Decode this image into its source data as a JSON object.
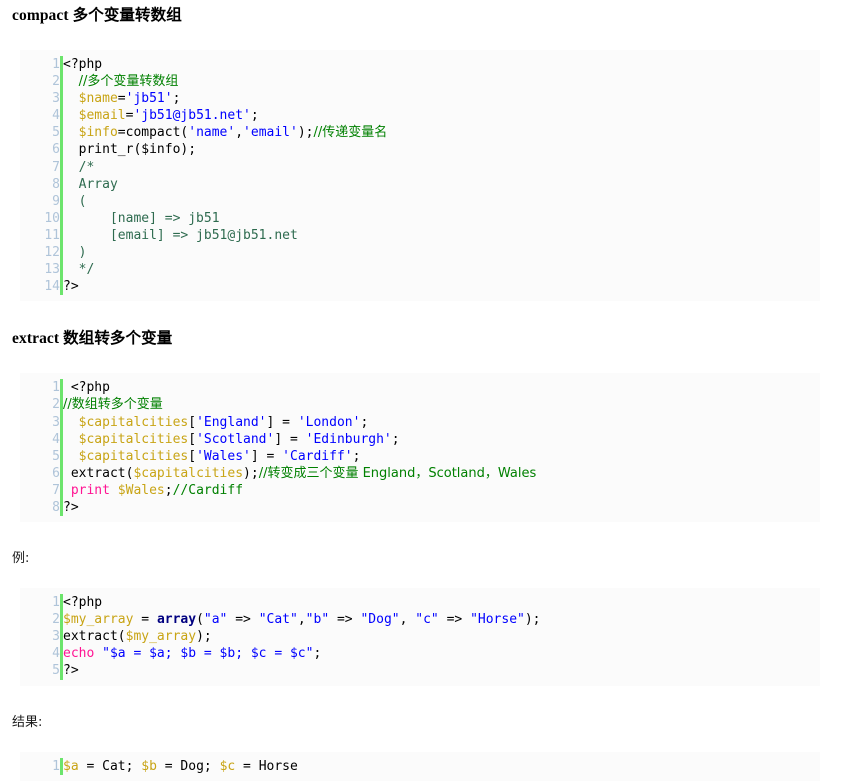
{
  "page": {
    "title": "PHP compact / extract 示例",
    "background": "#ffffff",
    "code_background": "#fbfbfb",
    "gutter_accent": "#6ce46c",
    "gutter_color": "#afc4d9"
  },
  "colors": {
    "variable": "#c8a415",
    "string": "#0000ff",
    "comment": "#008000",
    "block_comment": "#2e6b4f",
    "keyword": "#000080",
    "print_keyword": "#ff1493",
    "plain": "#000000"
  },
  "sections": [
    {
      "id": "compact",
      "heading": "compact 多个变量转数组",
      "block": {
        "line_numbers": [
          "1",
          "2",
          "3",
          "4",
          "5",
          "6",
          "7",
          "8",
          "9",
          "10",
          "11",
          "12",
          "13",
          "14"
        ],
        "lines": [
          [
            {
              "t": "<?php",
              "c": "plain"
            }
          ],
          [
            {
              "t": "  ",
              "c": "plain"
            },
            {
              "t": "//多个变量转数组",
              "c": "cjkcom"
            }
          ],
          [
            {
              "t": "  ",
              "c": "plain"
            },
            {
              "t": "$name",
              "c": "var"
            },
            {
              "t": "=",
              "c": "plain"
            },
            {
              "t": "'jb51'",
              "c": "str"
            },
            {
              "t": ";",
              "c": "plain"
            }
          ],
          [
            {
              "t": "  ",
              "c": "plain"
            },
            {
              "t": "$email",
              "c": "var"
            },
            {
              "t": "=",
              "c": "plain"
            },
            {
              "t": "'jb51@jb51.net'",
              "c": "str"
            },
            {
              "t": ";",
              "c": "plain"
            }
          ],
          [
            {
              "t": "  ",
              "c": "plain"
            },
            {
              "t": "$info",
              "c": "var"
            },
            {
              "t": "=compact(",
              "c": "plain"
            },
            {
              "t": "'name'",
              "c": "str"
            },
            {
              "t": ",",
              "c": "plain"
            },
            {
              "t": "'email'",
              "c": "str"
            },
            {
              "t": ");",
              "c": "plain"
            },
            {
              "t": "//传递变量名",
              "c": "cjkcom"
            }
          ],
          [
            {
              "t": "  print_r($info);",
              "c": "plain"
            }
          ],
          [
            {
              "t": "  ",
              "c": "plain"
            },
            {
              "t": "/*",
              "c": "blk"
            }
          ],
          [
            {
              "t": "  ",
              "c": "plain"
            },
            {
              "t": "Array",
              "c": "blk"
            }
          ],
          [
            {
              "t": "  ",
              "c": "plain"
            },
            {
              "t": "(",
              "c": "blk"
            }
          ],
          [
            {
              "t": "      ",
              "c": "plain"
            },
            {
              "t": "[name] => jb51",
              "c": "blk"
            }
          ],
          [
            {
              "t": "      ",
              "c": "plain"
            },
            {
              "t": "[email] => jb51@jb51.net",
              "c": "blk"
            }
          ],
          [
            {
              "t": "  ",
              "c": "plain"
            },
            {
              "t": ")",
              "c": "blk"
            }
          ],
          [
            {
              "t": "  ",
              "c": "plain"
            },
            {
              "t": "*/",
              "c": "blk"
            }
          ],
          [
            {
              "t": "?>",
              "c": "plain"
            }
          ]
        ]
      }
    },
    {
      "id": "extract",
      "heading": "extract 数组转多个变量",
      "block": {
        "line_numbers": [
          "1",
          "2",
          "3",
          "4",
          "5",
          "6",
          "7",
          "8"
        ],
        "lines": [
          [
            {
              "t": " <?php",
              "c": "plain"
            }
          ],
          [
            {
              "t": "//数组转多个变量",
              "c": "cjkcom"
            }
          ],
          [
            {
              "t": "  ",
              "c": "plain"
            },
            {
              "t": "$capitalcities",
              "c": "var"
            },
            {
              "t": "[",
              "c": "plain"
            },
            {
              "t": "'England'",
              "c": "str"
            },
            {
              "t": "] = ",
              "c": "plain"
            },
            {
              "t": "'London'",
              "c": "str"
            },
            {
              "t": ";",
              "c": "plain"
            }
          ],
          [
            {
              "t": "  ",
              "c": "plain"
            },
            {
              "t": "$capitalcities",
              "c": "var"
            },
            {
              "t": "[",
              "c": "plain"
            },
            {
              "t": "'Scotland'",
              "c": "str"
            },
            {
              "t": "] = ",
              "c": "plain"
            },
            {
              "t": "'Edinburgh'",
              "c": "str"
            },
            {
              "t": ";",
              "c": "plain"
            }
          ],
          [
            {
              "t": "  ",
              "c": "plain"
            },
            {
              "t": "$capitalcities",
              "c": "var"
            },
            {
              "t": "[",
              "c": "plain"
            },
            {
              "t": "'Wales'",
              "c": "str"
            },
            {
              "t": "] = ",
              "c": "plain"
            },
            {
              "t": "'Cardiff'",
              "c": "str"
            },
            {
              "t": ";",
              "c": "plain"
            }
          ],
          [
            {
              "t": " extract(",
              "c": "plain"
            },
            {
              "t": "$capitalcities",
              "c": "var"
            },
            {
              "t": ");",
              "c": "plain"
            },
            {
              "t": "//转变成三个变量 England，Scotland，Wales",
              "c": "cjkcom"
            }
          ],
          [
            {
              "t": " ",
              "c": "plain"
            },
            {
              "t": "print",
              "c": "pink"
            },
            {
              "t": " ",
              "c": "plain"
            },
            {
              "t": "$Wales",
              "c": "var"
            },
            {
              "t": ";",
              "c": "plain"
            },
            {
              "t": "//Cardiff",
              "c": "com"
            }
          ],
          [
            {
              "t": "?>",
              "c": "plain"
            }
          ]
        ]
      }
    },
    {
      "id": "example",
      "heading": "例:",
      "heading_style": "plain",
      "block": {
        "line_numbers": [
          "1",
          "2",
          "3",
          "4",
          "5"
        ],
        "lines": [
          [
            {
              "t": "<?php",
              "c": "plain"
            }
          ],
          [
            {
              "t": "$my_array",
              "c": "var"
            },
            {
              "t": " = ",
              "c": "plain"
            },
            {
              "t": "array",
              "c": "kw"
            },
            {
              "t": "(",
              "c": "plain"
            },
            {
              "t": "\"a\"",
              "c": "str"
            },
            {
              "t": " => ",
              "c": "plain"
            },
            {
              "t": "\"Cat\"",
              "c": "str"
            },
            {
              "t": ",",
              "c": "plain"
            },
            {
              "t": "\"b\"",
              "c": "str"
            },
            {
              "t": " => ",
              "c": "plain"
            },
            {
              "t": "\"Dog\"",
              "c": "str"
            },
            {
              "t": ", ",
              "c": "plain"
            },
            {
              "t": "\"c\"",
              "c": "str"
            },
            {
              "t": " => ",
              "c": "plain"
            },
            {
              "t": "\"Horse\"",
              "c": "str"
            },
            {
              "t": ");",
              "c": "plain"
            }
          ],
          [
            {
              "t": "extract(",
              "c": "plain"
            },
            {
              "t": "$my_array",
              "c": "var"
            },
            {
              "t": ");",
              "c": "plain"
            }
          ],
          [
            {
              "t": "echo",
              "c": "pink"
            },
            {
              "t": " ",
              "c": "plain"
            },
            {
              "t": "\"$a = $a; $b = $b; $c = $c\"",
              "c": "str"
            },
            {
              "t": ";",
              "c": "plain"
            }
          ],
          [
            {
              "t": "?>",
              "c": "plain"
            }
          ]
        ]
      }
    },
    {
      "id": "result",
      "heading": "结果:",
      "heading_style": "plain",
      "block": {
        "line_numbers": [
          "1"
        ],
        "lines": [
          [
            {
              "t": "$a",
              "c": "var"
            },
            {
              "t": " = Cat; ",
              "c": "plain"
            },
            {
              "t": "$b",
              "c": "var"
            },
            {
              "t": " = Dog; ",
              "c": "plain"
            },
            {
              "t": "$c",
              "c": "var"
            },
            {
              "t": " = Horse",
              "c": "plain"
            }
          ]
        ]
      }
    }
  ]
}
